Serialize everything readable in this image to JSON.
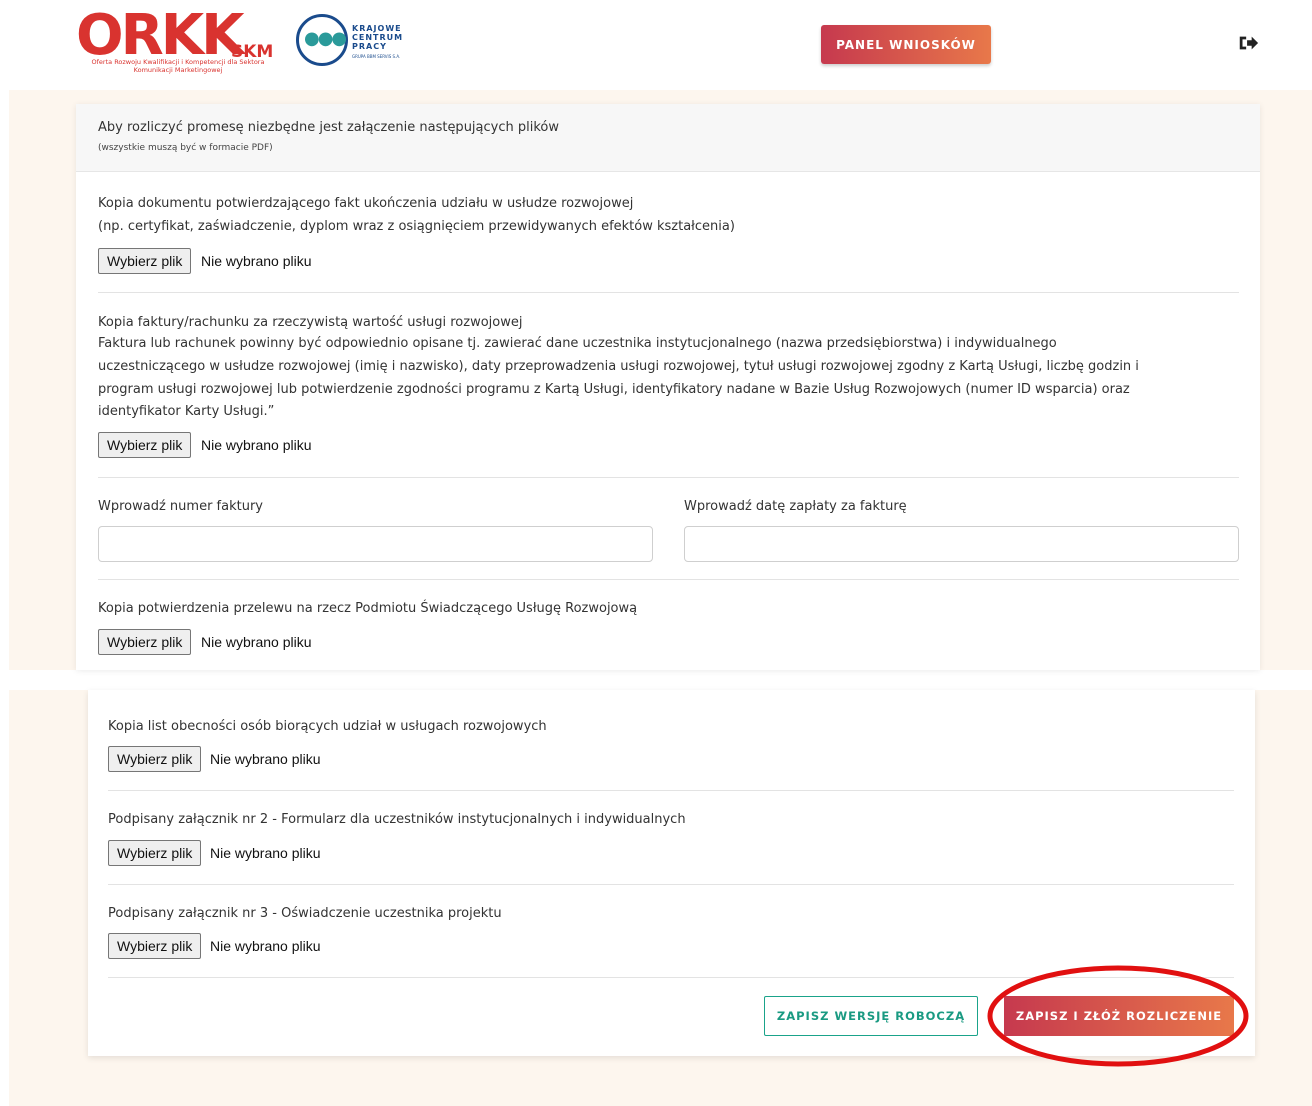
{
  "header": {
    "logo_orkk_main": "ORKK",
    "logo_orkk_skm": "SKM",
    "logo_orkk_subtitle": "Oferta Rozwoju Kwalifikacji i Kompetencji dla Sektora Komunikacji Marketingowej",
    "logo_kcp_line1": "KRAJOWE",
    "logo_kcp_line2": "CENTRUM",
    "logo_kcp_line3": "PRACY",
    "logo_kcp_tiny": "GRUPA BBM SERVIS S.A.",
    "panel_button": "PANEL WNIOSKÓW",
    "logout_icon": "sign-out-icon"
  },
  "form": {
    "intro_title": "Aby rozliczyć promesę niezbędne jest załączenie następujących plików",
    "intro_note": "(wszystkie muszą być w formacie PDF)",
    "file_button": "Wybierz plik",
    "file_none": "Nie wybrano pliku",
    "section1_line1": "Kopia dokumentu potwierdzającego fakt ukończenia udziału w usłudze rozwojowej",
    "section1_line2": "(np. certyfikat, zaświadczenie, dyplom wraz z osiągnięciem przewidywanych efektów kształcenia)",
    "section2_line1": "Kopia faktury/rachunku za rzeczywistą wartość usługi rozwojowej",
    "section2_line2": "Faktura lub rachunek powinny być odpowiednio opisane tj. zawierać dane uczestnika instytucjonalnego (nazwa przedsiębiorstwa) i indywidualnego",
    "section2_line3": "uczestniczącego w usłudze rozwojowej (imię i nazwisko), daty przeprowadzenia usługi rozwojowej, tytuł usługi rozwojowej zgodny z Kartą Usługi, liczbę godzin i",
    "section2_line4": "program usługi rozwojowej lub potwierdzenie zgodności programu z Kartą Usługi, identyfikatory nadane w Bazie Usług Rozwojowych (numer ID wsparcia) oraz",
    "section2_line5": "identyfikator Karty Usługi.”",
    "invoice_number_label": "Wprowadź numer faktury",
    "invoice_number_value": "",
    "payment_date_label": "Wprowadź datę zapłaty za fakturę",
    "payment_date_value": "",
    "section3_label": "Kopia potwierdzenia przelewu na rzecz Podmiotu Świadczącego Usługę Rozwojową",
    "section4_label": "Kopia list obecności osób biorących udział w usługach rozwojowych",
    "section5_label": "Podpisany załącznik nr 2 - Formularz dla uczestników instytucjonalnych i indywidualnych",
    "section6_label": "Podpisany załącznik nr 3 - Oświadczenie uczestnika projektu",
    "draft_button": "ZAPISZ WERSJĘ ROBOCZĄ",
    "submit_button": "ZAPISZ I ZŁÓŻ ROZLICZENIE"
  },
  "colors": {
    "accent_start": "#c6394e",
    "accent_end": "#e8784a",
    "draft_green": "#1a9a82",
    "page_background": "#fdf6ee",
    "highlight_ring": "#e11010"
  }
}
